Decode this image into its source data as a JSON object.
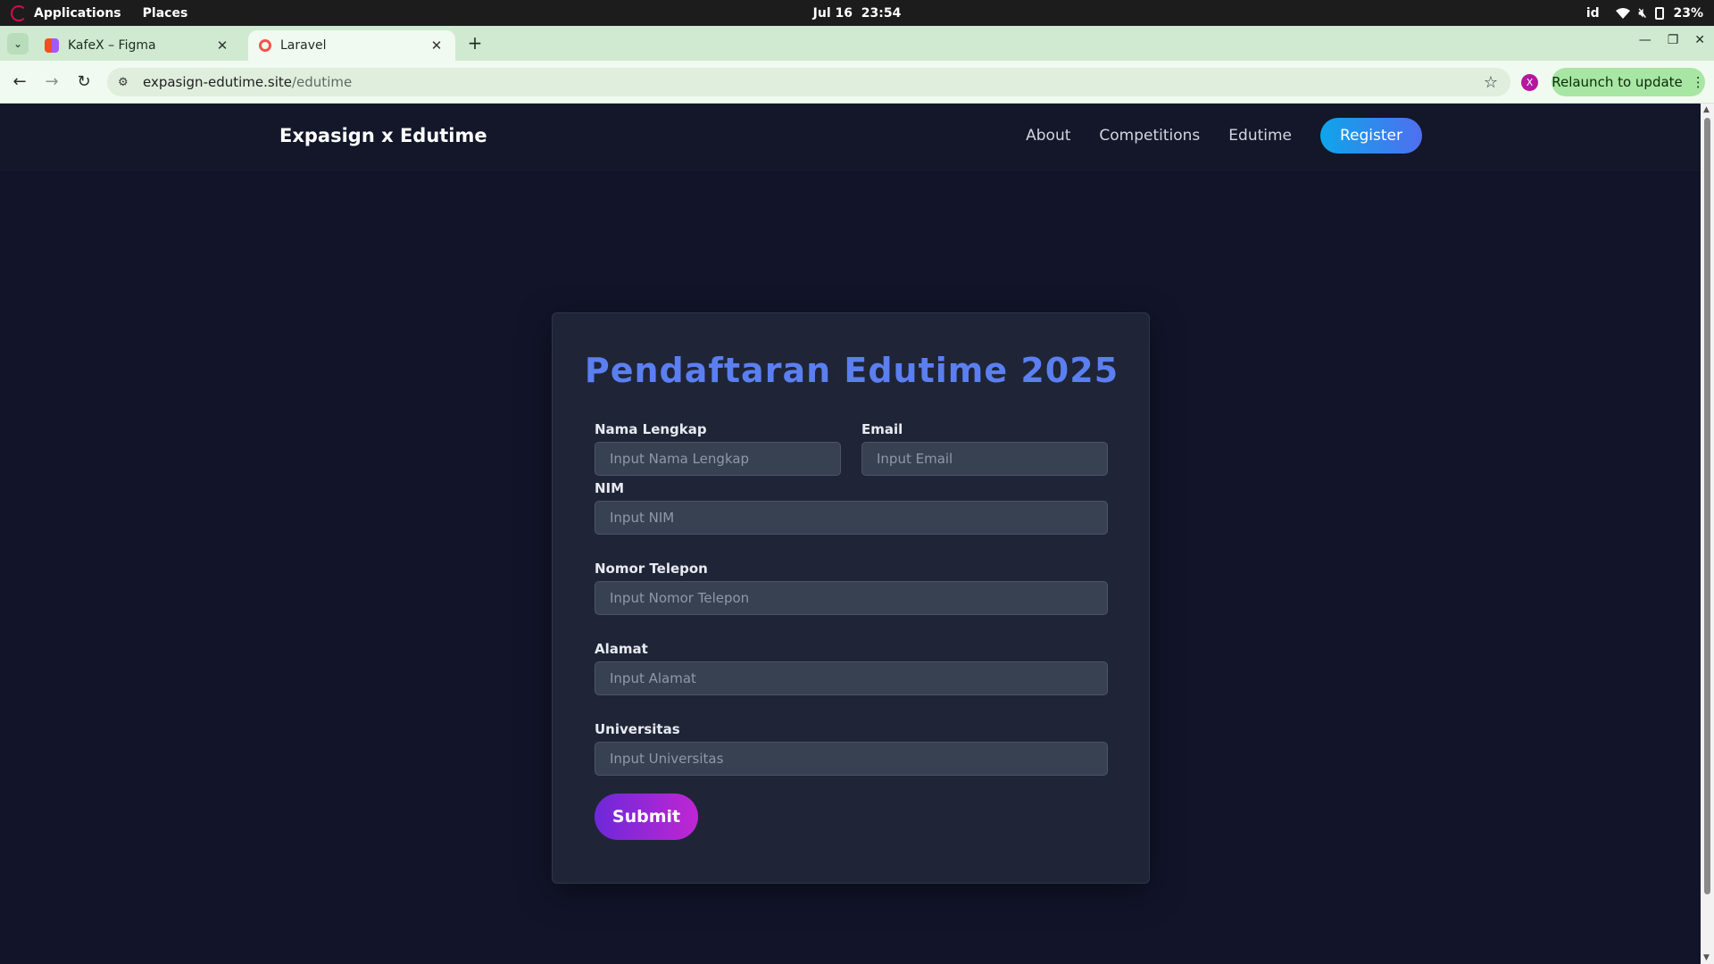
{
  "os_bar": {
    "applications": "Applications",
    "places": "Places",
    "date": "Jul 16",
    "time": "23:54",
    "keyboard_layout": "id",
    "battery": "23%"
  },
  "browser": {
    "tabs": [
      {
        "title": "KafeX – Figma",
        "active": false
      },
      {
        "title": "Laravel",
        "active": true
      }
    ],
    "url_host": "expasign-edutime.site",
    "url_path": "/edutime",
    "profile_initial": "X",
    "relaunch_label": "Relaunch to update"
  },
  "site": {
    "brand": "Expasign x Edutime",
    "nav": [
      "About",
      "Competitions",
      "Edutime"
    ],
    "register_label": "Register"
  },
  "form": {
    "title": "Pendaftaran Edutime 2025",
    "fields": {
      "nama": {
        "label": "Nama Lengkap",
        "placeholder": "Input Nama Lengkap"
      },
      "email": {
        "label": "Email",
        "placeholder": "Input Email"
      },
      "nim": {
        "label": "NIM",
        "placeholder": "Input NIM"
      },
      "telepon": {
        "label": "Nomor Telepon",
        "placeholder": "Input Nomor Telepon"
      },
      "alamat": {
        "label": "Alamat",
        "placeholder": "Input Alamat"
      },
      "universitas": {
        "label": "Universitas",
        "placeholder": "Input Universitas"
      }
    },
    "submit_label": "Submit"
  },
  "colors": {
    "page_bg": "#12152a",
    "card_bg": "#1f2537",
    "title_blue": "#5b7ff0",
    "register_gradient": [
      "#0ea5e9",
      "#4f6ff0"
    ],
    "submit_gradient": [
      "#6d28d9",
      "#c026d3"
    ]
  }
}
